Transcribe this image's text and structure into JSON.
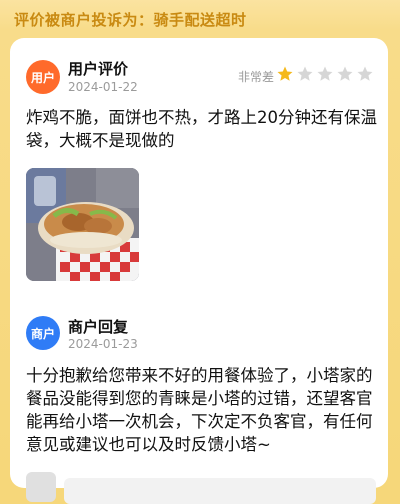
{
  "banner": {
    "text": "评价被商户投诉为：骑手配送超时"
  },
  "review": {
    "avatar_label": "用户",
    "author": "用户评价",
    "date": "2024-01-22",
    "rating_label": "非常差",
    "rating": 1,
    "rating_max": 5,
    "text": "炸鸡不脆，面饼也不热，才路上20分钟还有保温袋，大概不是现做的"
  },
  "reply": {
    "avatar_label": "商户",
    "author": "商户回复",
    "date": "2024-01-23",
    "text": "十分抱歉给您带来不好的用餐体验了，小塔家的餐品没能得到您的青睐是小塔的过错，还望客官能再给小塔一次机会，下次定不负客官，有任何意见或建议也可以及时反馈小塔~"
  },
  "colors": {
    "accent": "#c98a12",
    "star_on": "#f5b91b",
    "star_off": "#d6d6d6",
    "user_avatar": "#ff6a2b",
    "merchant_avatar": "#2f7cf6"
  }
}
